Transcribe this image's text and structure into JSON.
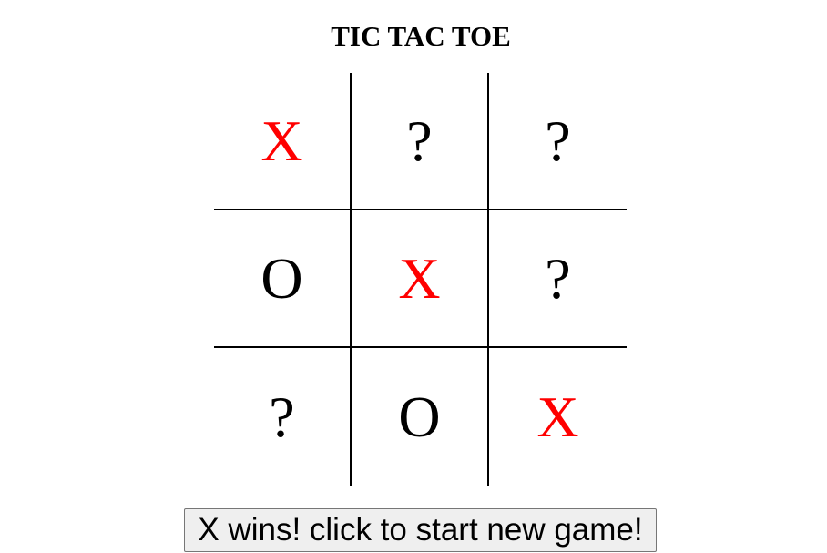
{
  "title": "TIC TAC TOE",
  "board": {
    "cells": [
      {
        "value": "X",
        "kind": "x"
      },
      {
        "value": "?",
        "kind": "q"
      },
      {
        "value": "?",
        "kind": "q"
      },
      {
        "value": "O",
        "kind": "o"
      },
      {
        "value": "X",
        "kind": "x"
      },
      {
        "value": "?",
        "kind": "q"
      },
      {
        "value": "?",
        "kind": "q"
      },
      {
        "value": "O",
        "kind": "o"
      },
      {
        "value": "X",
        "kind": "x"
      }
    ]
  },
  "colors": {
    "x_mark": "#ff0000",
    "o_mark": "#000000",
    "empty_mark": "#000000",
    "grid_lines": "#000000"
  },
  "status_button": {
    "label": "X wins! click to start new game!"
  }
}
